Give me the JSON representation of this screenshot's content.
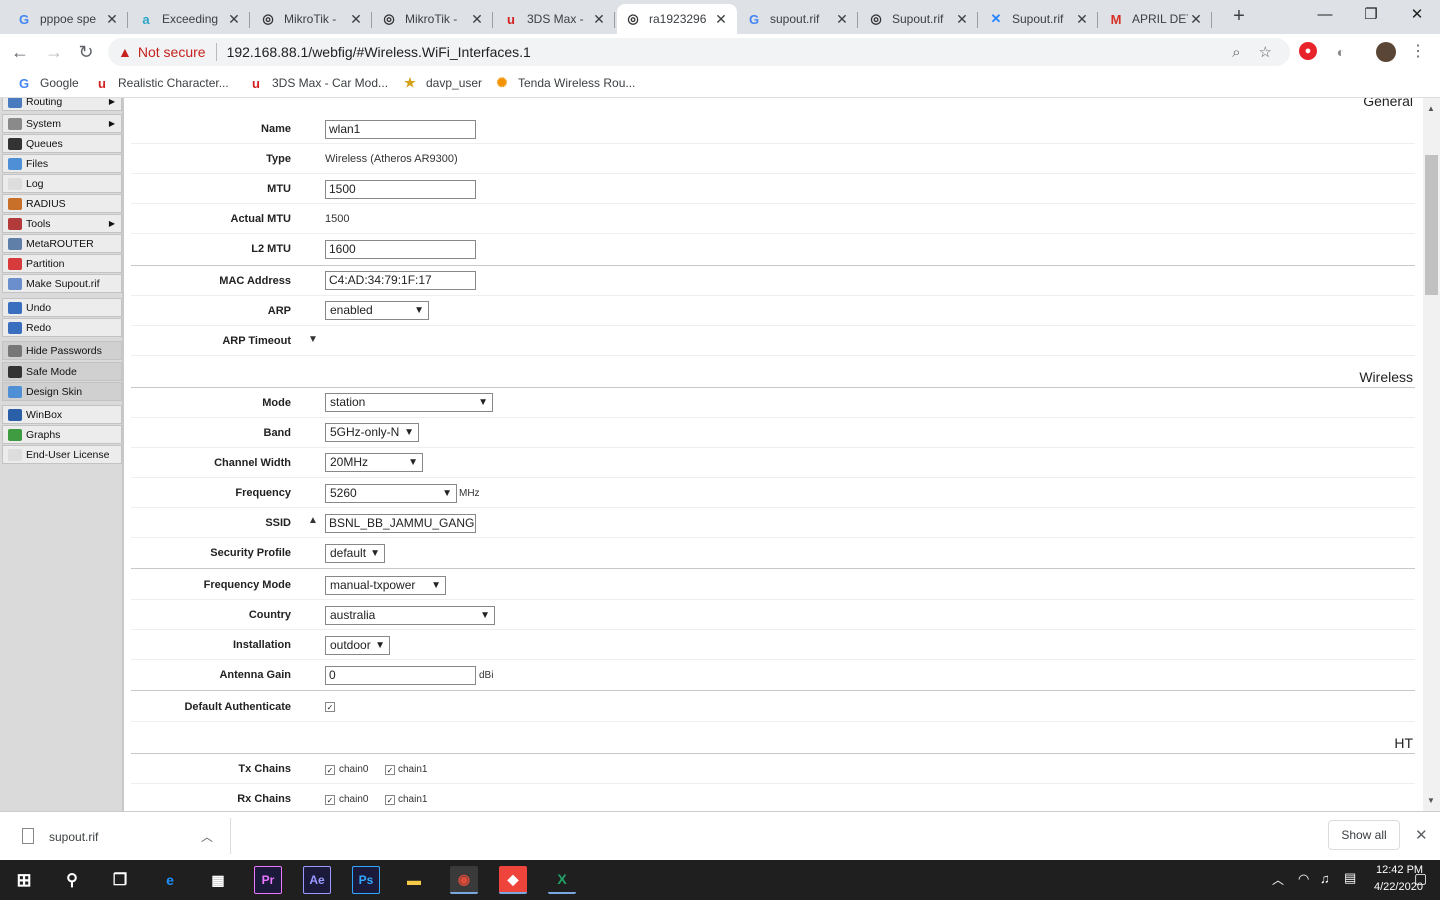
{
  "browser": {
    "tabs": [
      {
        "title": "pppoe spe",
        "icon": "google-icon",
        "glyph": "G",
        "color": "#4285f4",
        "active": false
      },
      {
        "title": "Exceeding",
        "icon": "amazon-icon",
        "glyph": "a",
        "color": "#2aa5c7",
        "active": false
      },
      {
        "title": "MikroTik -",
        "icon": "mikrotik-icon",
        "glyph": "◎",
        "color": "#333333",
        "active": false
      },
      {
        "title": "MikroTik -",
        "icon": "mikrotik-icon",
        "glyph": "◎",
        "color": "#333333",
        "active": false
      },
      {
        "title": "3DS Max -",
        "icon": "3ds-icon",
        "glyph": "u",
        "color": "#d21f1f",
        "active": false
      },
      {
        "title": "ra1923296",
        "icon": "mikrotik-icon",
        "glyph": "◎",
        "color": "#333333",
        "active": true
      },
      {
        "title": "supout.rif",
        "icon": "google-icon",
        "glyph": "G",
        "color": "#4285f4",
        "active": false
      },
      {
        "title": "Supout.rif",
        "icon": "mikrotik-icon",
        "glyph": "◎",
        "color": "#333333",
        "active": false
      },
      {
        "title": "Supout.rif",
        "icon": "confluence-icon",
        "glyph": "✕",
        "color": "#2684ff",
        "active": false
      },
      {
        "title": "APRIL DET",
        "icon": "gmail-icon",
        "glyph": "M",
        "color": "#d93025",
        "active": false
      }
    ],
    "new_tab_glyph": "+",
    "window_controls": {
      "minimize": "—",
      "maximize": "❐",
      "close": "✕"
    },
    "nav": {
      "back": "←",
      "forward": "→",
      "reload": "↻"
    },
    "security_warning": "Not secure",
    "url": "192.168.88.1/webfig/#Wireless.WiFi_Interfaces.1",
    "bookmarks": [
      {
        "label": "Google",
        "icon": "google-icon",
        "glyph": "G",
        "color": "#4285f4"
      },
      {
        "label": "Realistic Character...",
        "icon": "3ds-icon",
        "glyph": "u",
        "color": "#d21f1f"
      },
      {
        "label": "3DS Max - Car Mod...",
        "icon": "3ds-icon",
        "glyph": "u",
        "color": "#d21f1f"
      },
      {
        "label": "davp_user",
        "icon": "user-icon",
        "glyph": "★",
        "color": "#d4a017"
      },
      {
        "label": "Tenda Wireless Rou...",
        "icon": "tenda-icon",
        "glyph": "✺",
        "color": "#f29200"
      }
    ]
  },
  "sidebar": {
    "items": [
      {
        "label": "Routing",
        "icon": "routing-icon",
        "color": "#4a7bbf",
        "submenu": true
      },
      {
        "label": "System",
        "icon": "gear-icon",
        "color": "#8a8a8a",
        "submenu": true
      },
      {
        "label": "Queues",
        "icon": "queues-icon",
        "color": "#333333",
        "submenu": false
      },
      {
        "label": "Files",
        "icon": "folder-icon",
        "color": "#4f8fd6",
        "submenu": false
      },
      {
        "label": "Log",
        "icon": "log-icon",
        "color": "#dddddd",
        "submenu": false
      },
      {
        "label": "RADIUS",
        "icon": "radius-icon",
        "color": "#c86f2a",
        "submenu": false
      },
      {
        "label": "Tools",
        "icon": "tools-icon",
        "color": "#b33a3a",
        "submenu": true
      },
      {
        "label": "MetaROUTER",
        "icon": "metarouter-icon",
        "color": "#5f7ea8",
        "submenu": false
      },
      {
        "label": "Partition",
        "icon": "partition-icon",
        "color": "#d63a3a",
        "submenu": false
      },
      {
        "label": "Make Supout.rif",
        "icon": "supout-icon",
        "color": "#6a8fcc",
        "submenu": false
      },
      {
        "label": "Undo",
        "icon": "undo-icon",
        "color": "#3a6fbf",
        "submenu": false
      },
      {
        "label": "Redo",
        "icon": "redo-icon",
        "color": "#3a6fbf",
        "submenu": false
      },
      {
        "label": "Hide Passwords",
        "icon": "password-icon",
        "color": "#777777",
        "submenu": false
      },
      {
        "label": "Safe Mode",
        "icon": "umbrella-icon",
        "color": "#333333",
        "submenu": false
      },
      {
        "label": "Design Skin",
        "icon": "skin-icon",
        "color": "#4f8fd6",
        "submenu": false
      },
      {
        "label": "WinBox",
        "icon": "winbox-icon",
        "color": "#2b5fa8",
        "submenu": false
      },
      {
        "label": "Graphs",
        "icon": "graphs-icon",
        "color": "#3f9b3f",
        "submenu": false
      },
      {
        "label": "End-User License",
        "icon": "license-icon",
        "color": "#dddddd",
        "submenu": false
      }
    ]
  },
  "form": {
    "sections": {
      "general": "General",
      "wireless": "Wireless",
      "ht": "HT"
    },
    "name": {
      "label": "Name",
      "value": "wlan1"
    },
    "type": {
      "label": "Type",
      "value": "Wireless (Atheros AR9300)"
    },
    "mtu": {
      "label": "MTU",
      "value": "1500"
    },
    "actual_mtu": {
      "label": "Actual MTU",
      "value": "1500"
    },
    "l2_mtu": {
      "label": "L2 MTU",
      "value": "1600"
    },
    "mac": {
      "label": "MAC Address",
      "value": "C4:AD:34:79:1F:17"
    },
    "arp": {
      "label": "ARP",
      "value": "enabled"
    },
    "arp_timeout": {
      "label": "ARP Timeout"
    },
    "mode": {
      "label": "Mode",
      "value": "station"
    },
    "band": {
      "label": "Band",
      "value": "5GHz-only-N"
    },
    "channel_width": {
      "label": "Channel Width",
      "value": "20MHz"
    },
    "frequency": {
      "label": "Frequency",
      "value": "5260",
      "unit": "MHz"
    },
    "ssid": {
      "label": "SSID",
      "value": "BSNL_BB_JAMMU_GANG"
    },
    "security_profile": {
      "label": "Security Profile",
      "value": "default"
    },
    "frequency_mode": {
      "label": "Frequency Mode",
      "value": "manual-txpower"
    },
    "country": {
      "label": "Country",
      "value": "australia"
    },
    "installation": {
      "label": "Installation",
      "value": "outdoor"
    },
    "antenna_gain": {
      "label": "Antenna Gain",
      "value": "0",
      "unit": "dBi"
    },
    "default_auth": {
      "label": "Default Authenticate",
      "checked": true
    },
    "tx_chains": {
      "label": "Tx Chains",
      "chain0": "chain0",
      "chain1": "chain1"
    },
    "rx_chains": {
      "label": "Rx Chains",
      "chain0": "chain0",
      "chain1": "chain1"
    }
  },
  "download": {
    "filename": "supout.rif",
    "show_all": "Show all"
  },
  "taskbar": {
    "time": "12:42 PM",
    "date": "4/22/2020",
    "apps": [
      {
        "icon": "edge-icon",
        "glyph": "e",
        "color": "#1e90ff"
      },
      {
        "icon": "store-icon",
        "glyph": "▦",
        "color": "#ffffff"
      },
      {
        "icon": "premiere-icon",
        "glyph": "Pr",
        "color": "#ea77ff"
      },
      {
        "icon": "aftereffects-icon",
        "glyph": "Ae",
        "color": "#9999ff"
      },
      {
        "icon": "photoshop-icon",
        "glyph": "Ps",
        "color": "#31a8ff"
      },
      {
        "icon": "explorer-icon",
        "glyph": "▬",
        "color": "#f7c948"
      },
      {
        "icon": "chrome-icon",
        "glyph": "◉",
        "color": "#dd4b39"
      },
      {
        "icon": "anydesk-icon",
        "glyph": "◆",
        "color": "#ef443b"
      },
      {
        "icon": "excel-icon",
        "glyph": "X",
        "color": "#21a366"
      }
    ]
  }
}
